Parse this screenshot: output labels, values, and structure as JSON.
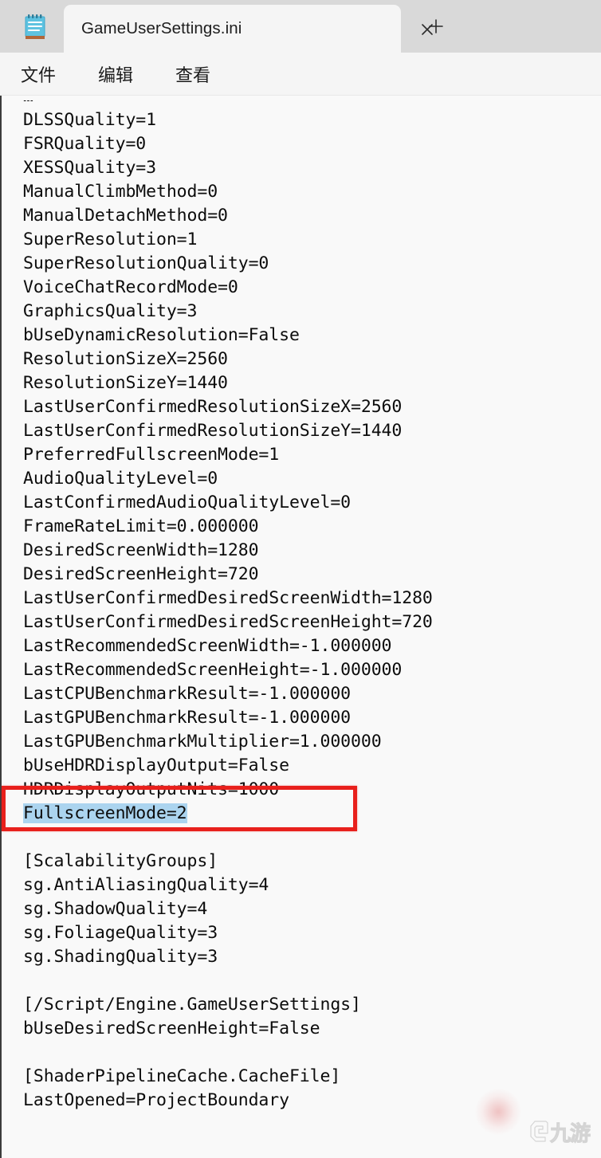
{
  "window": {
    "app_icon": "notepad-icon",
    "tab_title": "GameUserSettings.ini",
    "close_icon": "close-icon",
    "new_tab_icon": "plus-icon"
  },
  "menubar": {
    "items": [
      {
        "label": "文件",
        "name": "menu-file"
      },
      {
        "label": "编辑",
        "name": "menu-edit"
      },
      {
        "label": "查看",
        "name": "menu-view"
      }
    ]
  },
  "colors": {
    "titlebar_bg": "#d9d9d9",
    "active_tab_bg": "#f5f5f5",
    "editor_bg": "#f9f9f9",
    "text": "#0c0c0c",
    "selection_highlight": "#abd4ef",
    "annotation_red": "#e8201c"
  },
  "editor": {
    "clipped_top_line": "…",
    "lines": [
      {
        "text": "DLSSQuality=1"
      },
      {
        "text": "FSRQuality=0"
      },
      {
        "text": "XESSQuality=3"
      },
      {
        "text": "ManualClimbMethod=0"
      },
      {
        "text": "ManualDetachMethod=0"
      },
      {
        "text": "SuperResolution=1"
      },
      {
        "text": "SuperResolutionQuality=0"
      },
      {
        "text": "VoiceChatRecordMode=0"
      },
      {
        "text": "GraphicsQuality=3"
      },
      {
        "text": "bUseDynamicResolution=False"
      },
      {
        "text": "ResolutionSizeX=2560"
      },
      {
        "text": "ResolutionSizeY=1440"
      },
      {
        "text": "LastUserConfirmedResolutionSizeX=2560"
      },
      {
        "text": "LastUserConfirmedResolutionSizeY=1440"
      },
      {
        "text": "PreferredFullscreenMode=1"
      },
      {
        "text": "AudioQualityLevel=0"
      },
      {
        "text": "LastConfirmedAudioQualityLevel=0"
      },
      {
        "text": "FrameRateLimit=0.000000"
      },
      {
        "text": "DesiredScreenWidth=1280"
      },
      {
        "text": "DesiredScreenHeight=720"
      },
      {
        "text": "LastUserConfirmedDesiredScreenWidth=1280"
      },
      {
        "text": "LastUserConfirmedDesiredScreenHeight=720"
      },
      {
        "text": "LastRecommendedScreenWidth=-1.000000"
      },
      {
        "text": "LastRecommendedScreenHeight=-1.000000"
      },
      {
        "text": "LastCPUBenchmarkResult=-1.000000"
      },
      {
        "text": "LastGPUBenchmarkResult=-1.000000"
      },
      {
        "text": "LastGPUBenchmarkMultiplier=1.000000"
      },
      {
        "text": "bUseHDRDisplayOutput=False"
      },
      {
        "text": "HDRDisplayOutputNits=1000"
      },
      {
        "text": "FullscreenMode=2",
        "selected": true
      },
      {
        "text": ""
      },
      {
        "text": "[ScalabilityGroups]"
      },
      {
        "text": "sg.AntiAliasingQuality=4"
      },
      {
        "text": "sg.ShadowQuality=4"
      },
      {
        "text": "sg.FoliageQuality=3"
      },
      {
        "text": "sg.ShadingQuality=3"
      },
      {
        "text": ""
      },
      {
        "text": "[/Script/Engine.GameUserSettings]"
      },
      {
        "text": "bUseDesiredScreenHeight=False"
      },
      {
        "text": ""
      },
      {
        "text": "[ShaderPipelineCache.CacheFile]"
      },
      {
        "text": "LastOpened=ProjectBoundary"
      }
    ],
    "selected_text": "FullscreenMode=2"
  },
  "annotation": {
    "type": "red-rectangle-highlight",
    "target_line": "FullscreenMode=2"
  },
  "watermark": {
    "text": "九游"
  }
}
